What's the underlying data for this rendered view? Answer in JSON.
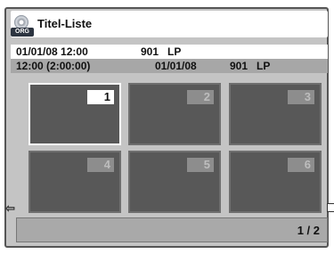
{
  "header": {
    "title": "Titel-Liste",
    "icon": "disc-icon",
    "badge": "ORG"
  },
  "current_info": {
    "datetime": "01/01/08 12:00",
    "channel": "901",
    "mode": "LP"
  },
  "selected_info": {
    "time_range": "12:00 (2:00:00)",
    "date": "01/01/08",
    "channel": "901",
    "mode": "LP"
  },
  "thumbnails": [
    {
      "number": "1",
      "selected": true
    },
    {
      "number": "2",
      "selected": false
    },
    {
      "number": "3",
      "selected": false
    },
    {
      "number": "4",
      "selected": false
    },
    {
      "number": "5",
      "selected": false
    },
    {
      "number": "6",
      "selected": false
    }
  ],
  "nav": {
    "left_arrow": "⇦"
  },
  "footer": {
    "page": "1 / 2"
  },
  "colors": {
    "selected_border": "#ffffff",
    "thumb_bg": "#585858",
    "panel_bg": "#c4c4c4"
  }
}
